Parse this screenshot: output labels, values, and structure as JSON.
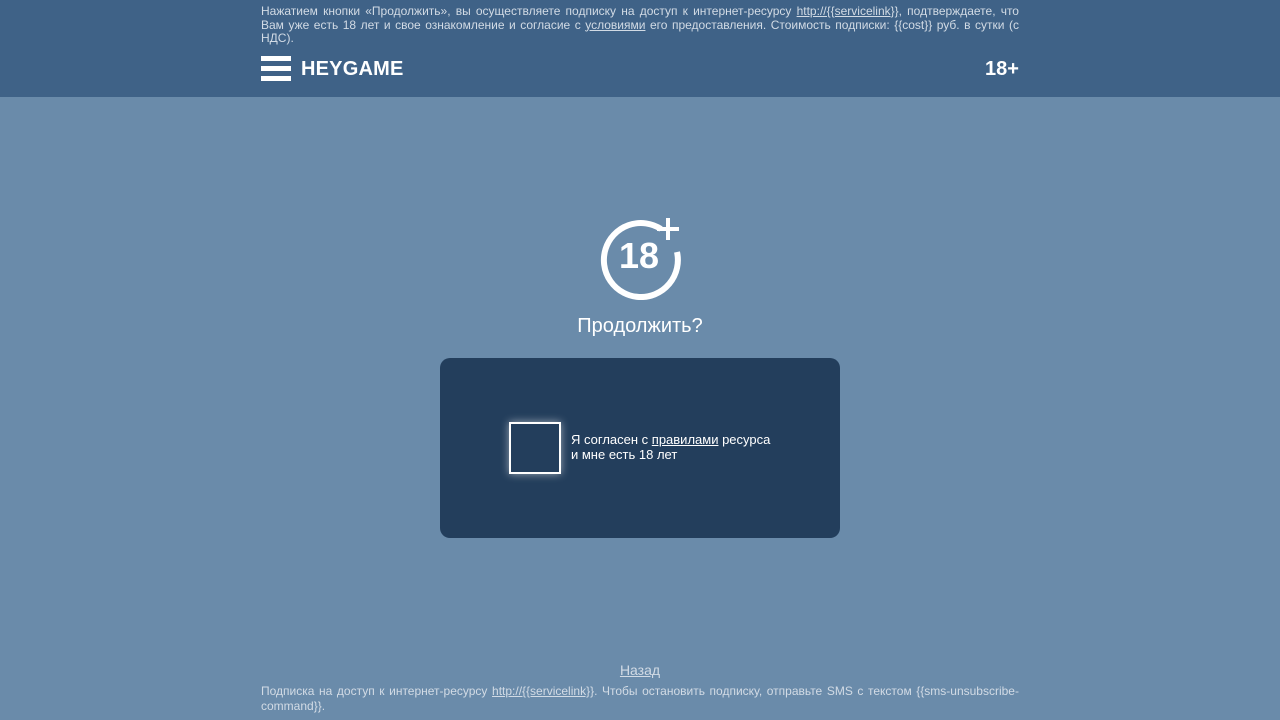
{
  "header": {
    "disclaimer_part1": "Нажатием кнопки «Продолжить», вы осуществляете подписку на доступ к интернет-ресурсу ",
    "disclaimer_link1": "http://{{servicelink}}",
    "disclaimer_part2": ", подтверждаете, что Вам уже есть 18 лет и свое ознакомление и согласие с ",
    "disclaimer_link2": "условиями",
    "disclaimer_part3": " его предоставления. Стоимость подписки: {{cost}} руб. в сутки (с НДС).",
    "logo": "HEYGAME",
    "age_badge": "18+",
    "menu_icon": "hamburger-menu-icon"
  },
  "main": {
    "age_icon_text": "18",
    "question": "Продолжить?",
    "consent": {
      "part1": "Я согласен с ",
      "link": "правилами",
      "part2": " ресурса",
      "line2": "и мне есть 18 лет",
      "checked": false
    }
  },
  "footer": {
    "back_link": "Назад",
    "text_part1": "Подписка на доступ к интернет-ресурсу ",
    "text_link": "http://{{servicelink}}",
    "text_part2": ". Чтобы остановить подписку, отправьте SMS с текстом {{sms-unsubscribe-command}}."
  },
  "colors": {
    "header_bg": "#3f6287",
    "page_bg": "#6a8baa",
    "panel_bg": "#233e5c",
    "text_light": "#d2dbe5",
    "text_white": "#ffffff"
  }
}
